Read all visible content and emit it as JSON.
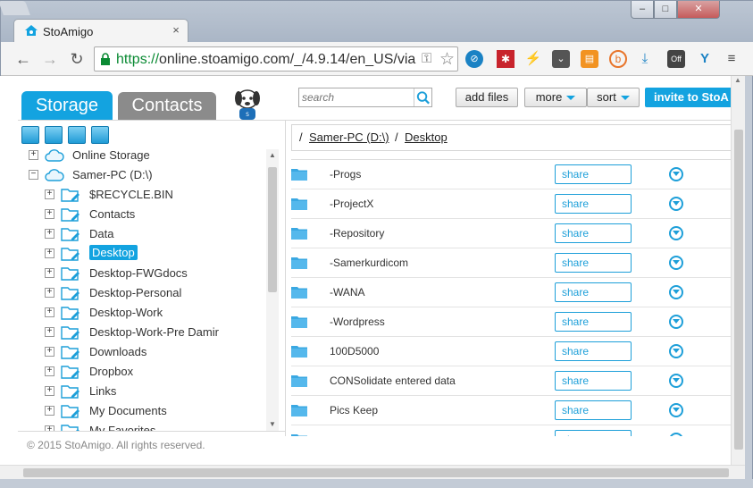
{
  "browser": {
    "tab_title": "StoAmigo",
    "url_scheme": "https://",
    "url_rest": "online.stoamigo.com/_/4.9.14/en_US/via",
    "win_min": "–",
    "win_max": "□",
    "win_close": "✕",
    "back": "←",
    "forward": "→",
    "reload": "↻",
    "extensions": [
      "lastpass-icon",
      "bugzilla-icon",
      "bolt-icon",
      "pocket-icon",
      "rss-icon",
      "b-icon",
      "download-icon",
      "off-icon",
      "v-icon",
      "menu-icon"
    ]
  },
  "app": {
    "tabs": {
      "storage": "Storage",
      "contacts": "Contacts"
    },
    "search": {
      "placeholder": "search"
    },
    "buttons": {
      "add_files": "add files",
      "more": "more",
      "sort": "sort",
      "invite": "invite to StoA"
    },
    "tree": [
      {
        "label": "Online Storage",
        "level": 0,
        "expander": "+",
        "icon": "cloud-icon"
      },
      {
        "label": "Samer-PC (D:\\)",
        "level": 0,
        "expander": "−",
        "icon": "cloud-icon"
      },
      {
        "label": "$RECYCLE.BIN",
        "level": 1,
        "expander": "+",
        "icon": "folder-icon"
      },
      {
        "label": "Contacts",
        "level": 1,
        "expander": "+",
        "icon": "folder-icon"
      },
      {
        "label": "Data",
        "level": 1,
        "expander": "+",
        "icon": "folder-icon"
      },
      {
        "label": "Desktop",
        "level": 1,
        "expander": "+",
        "icon": "folder-icon",
        "selected": true
      },
      {
        "label": "Desktop-FWGdocs",
        "level": 1,
        "expander": "+",
        "icon": "folder-icon"
      },
      {
        "label": "Desktop-Personal",
        "level": 1,
        "expander": "+",
        "icon": "folder-icon"
      },
      {
        "label": "Desktop-Work",
        "level": 1,
        "expander": "+",
        "icon": "folder-icon"
      },
      {
        "label": "Desktop-Work-Pre Damir",
        "level": 1,
        "expander": "+",
        "icon": "folder-icon"
      },
      {
        "label": "Downloads",
        "level": 1,
        "expander": "+",
        "icon": "folder-icon"
      },
      {
        "label": "Dropbox",
        "level": 1,
        "expander": "+",
        "icon": "folder-icon"
      },
      {
        "label": "Links",
        "level": 1,
        "expander": "+",
        "icon": "folder-icon"
      },
      {
        "label": "My Documents",
        "level": 1,
        "expander": "+",
        "icon": "folder-icon"
      },
      {
        "label": "My Favorites",
        "level": 1,
        "expander": "+",
        "icon": "folder-icon"
      }
    ],
    "breadcrumb": {
      "sep1": "/",
      "drive": "Samer-PC (D:\\)",
      "sep2": "/",
      "folder": "Desktop"
    },
    "files": [
      {
        "name": "-Progs",
        "share": "share"
      },
      {
        "name": "-ProjectX",
        "share": "share"
      },
      {
        "name": "-Repository",
        "share": "share"
      },
      {
        "name": "-Samerkurdicom",
        "share": "share"
      },
      {
        "name": "-WANA",
        "share": "share"
      },
      {
        "name": "-Wordpress",
        "share": "share"
      },
      {
        "name": "100D5000",
        "share": "share"
      },
      {
        "name": "CONSolidate entered data",
        "share": "share"
      },
      {
        "name": "Pics Keep",
        "share": "share"
      },
      {
        "name": "",
        "share": "share"
      }
    ],
    "footer": "© 2015 StoAmigo. All rights reserved.",
    "colors": {
      "accent": "#13a3e0",
      "tab_inactive": "#8b8b8b"
    }
  }
}
